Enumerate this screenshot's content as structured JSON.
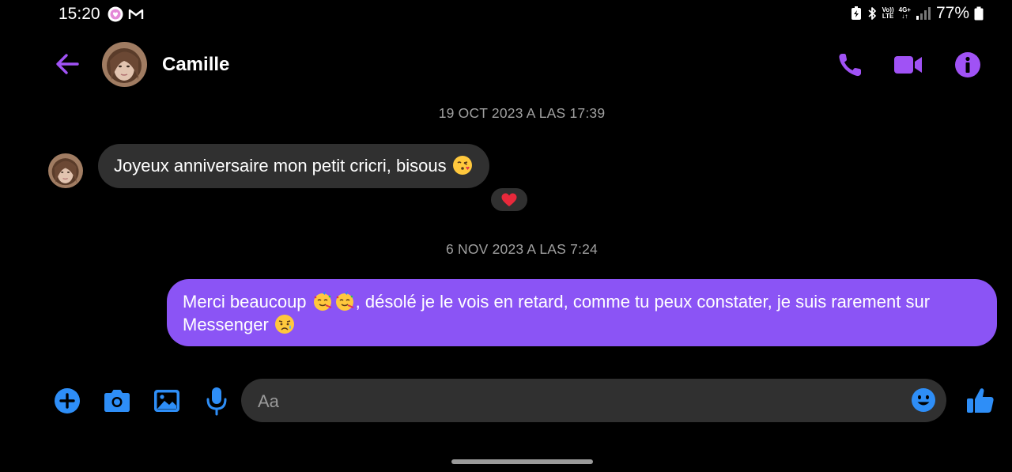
{
  "status_bar": {
    "time": "15:20",
    "volte_line1": "Vo))",
    "volte_line2": "LTE",
    "network_type": "4G+",
    "battery_percent": "77%"
  },
  "header": {
    "contact_name": "Camille"
  },
  "messages": [
    {
      "timestamp": "19 OCT 2023 A LAS 17:39",
      "direction": "incoming",
      "text": "Joyeux anniversaire mon petit cricri, bisous",
      "reaction": "heart"
    },
    {
      "timestamp": "6 NOV 2023 A LAS 7:24",
      "direction": "outgoing",
      "text_part1": "Merci beaucoup",
      "text_part2": ", désolé je le vois en retard, comme tu peux constater, je suis rarement sur Messenger"
    }
  ],
  "composer": {
    "placeholder": "Aa"
  },
  "icons": {
    "back": "arrow-left-icon",
    "call": "phone-icon",
    "video": "video-camera-icon",
    "info": "info-icon",
    "add": "plus-icon",
    "camera": "camera-icon",
    "gallery": "image-icon",
    "mic": "microphone-icon",
    "emoji": "smiley-icon",
    "like": "thumbs-up-icon"
  },
  "colors": {
    "background": "#000000",
    "accent_header": "#A052F5",
    "accent_composer": "#2E8EF7",
    "outgoing_bubble": "#8B54F5",
    "incoming_bubble": "#303030",
    "timestamp_text": "#A0A0A0"
  }
}
